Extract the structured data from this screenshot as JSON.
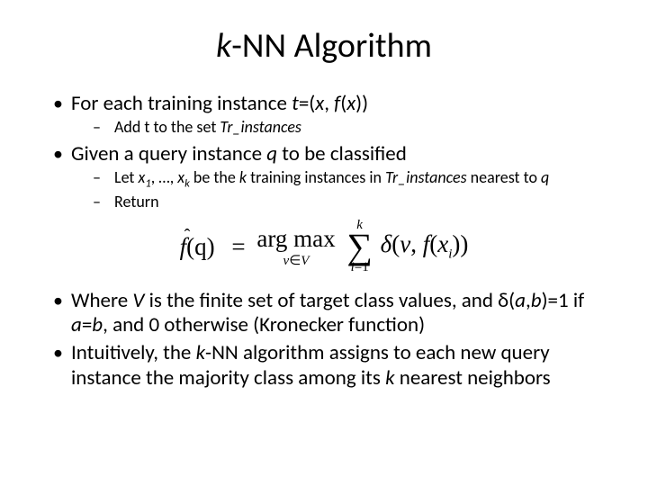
{
  "title_k": "k",
  "title_rest": "-NN Algorithm",
  "bullets": {
    "b1_pre": "For each training instance ",
    "b1_t": "t",
    "b1_mid1": "=(",
    "b1_x": "x",
    "b1_mid2": ", ",
    "b1_fx": "f",
    "b1_mid3": "(",
    "b1_x2": "x",
    "b1_end": "))",
    "b1a_pre": "Add t to the set ",
    "b1a_set": "Tr_instances",
    "b2_pre": "Given a query instance ",
    "b2_q": "q",
    "b2_end": " to be classified",
    "b2a_pre": "Let ",
    "b2a_x1": "x",
    "b2a_sub1": "1",
    "b2a_mid1": ", …, ",
    "b2a_xk": "x",
    "b2a_subk": "k",
    "b2a_mid2": " be the ",
    "b2a_k": "k",
    "b2a_mid3": " training instances in ",
    "b2a_set": "Tr_instances",
    "b2a_mid4": " nearest to ",
    "b2a_q": "q",
    "b2b": "Return",
    "b3_pre": "Where ",
    "b3_V": "V",
    "b3_mid1": " is the finite set of target class values, and δ(",
    "b3_a": "a",
    "b3_mid2": ",",
    "b3_b": "b",
    "b3_mid3": ")=1 if ",
    "b3_a2": "a",
    "b3_mid4": "=",
    "b3_b2": "b",
    "b3_end": ", and 0 otherwise (Kronecker function)",
    "b4_pre": "Intuitively, the ",
    "b4_k": "k",
    "b4_mid": "-NN algorithm assigns to each new query instance the majority class among its ",
    "b4_k2": "k",
    "b4_end": " nearest neighbors"
  },
  "formula": {
    "fhat_hat": "ˆ",
    "fhat_f": "f",
    "fhat_arg": "(q)",
    "eq": "=",
    "argmax": "arg max",
    "argmax_sub_v": "v",
    "argmax_sub_in": "∈",
    "argmax_sub_V": "V",
    "sigma_top": "k",
    "sigma": "∑",
    "sigma_bot_i": "i",
    "sigma_bot_eq": "=1",
    "delta": "δ",
    "rhs_open": "(",
    "rhs_v": "v",
    "rhs_comma": ", ",
    "rhs_f": "f",
    "rhs_open2": "(",
    "rhs_x": "x",
    "rhs_sub_i": "i",
    "rhs_close": "))"
  }
}
